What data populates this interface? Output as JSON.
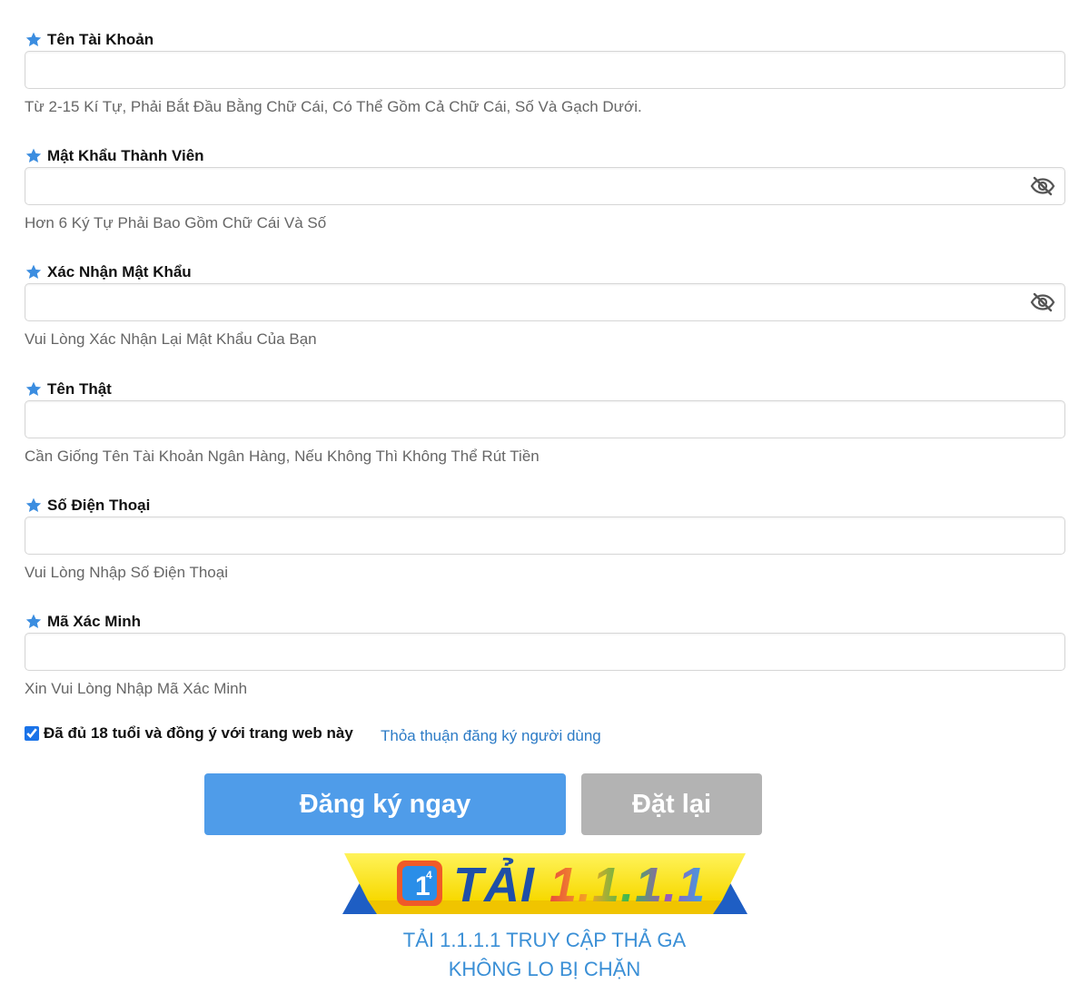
{
  "fields": [
    {
      "label": "Tên Tài Khoản",
      "hint": "Từ 2-15 Kí Tự, Phải Bắt Đầu Bằng Chữ Cái, Có Thể Gồm Cả Chữ Cái, Số Và Gạch Dưới.",
      "value": ""
    },
    {
      "label": "Mật Khẩu Thành Viên",
      "hint": "Hơn 6 Ký Tự Phải Bao Gồm Chữ Cái Và Số",
      "value": ""
    },
    {
      "label": "Xác Nhận Mật Khẩu",
      "hint": "Vui Lòng Xác Nhận Lại Mật Khẩu Của Bạn",
      "value": ""
    },
    {
      "label": "Tên Thật",
      "hint": "Cần Giống Tên Tài Khoản Ngân Hàng, Nếu Không Thì Không Thể Rút Tiền",
      "value": ""
    },
    {
      "label": "Số Điện Thoại",
      "hint": "Vui Lòng Nhập Số Điện Thoại",
      "value": ""
    },
    {
      "label": "Mã Xác Minh",
      "hint": "Xin Vui Lòng Nhập Mã Xác Minh",
      "value": ""
    }
  ],
  "agree": {
    "text": "Đã đủ 18 tuổi và đồng ý với trang web này",
    "link": "Thỏa thuận đăng ký người dùng",
    "checked": true
  },
  "buttons": {
    "submit": "Đăng ký ngay",
    "reset": "Đặt lại"
  },
  "banner": {
    "tai": "TẢI",
    "num": "1.1.1.1",
    "logo_text": "1"
  },
  "promo": {
    "line1": "TẢI 1.1.1.1 TRUY CẬP THẢ GA",
    "line2": "KHÔNG LO BỊ CHẶN"
  },
  "icons": {
    "required": "star-icon",
    "password_toggle": "eye-slash-icon"
  },
  "colors": {
    "star": "#3b8de0",
    "primary_button": "#4f9ce9",
    "reset_button": "#b3b3b3",
    "link": "#2c7bc6",
    "hint": "#666666",
    "promo": "#3a8fd6"
  }
}
